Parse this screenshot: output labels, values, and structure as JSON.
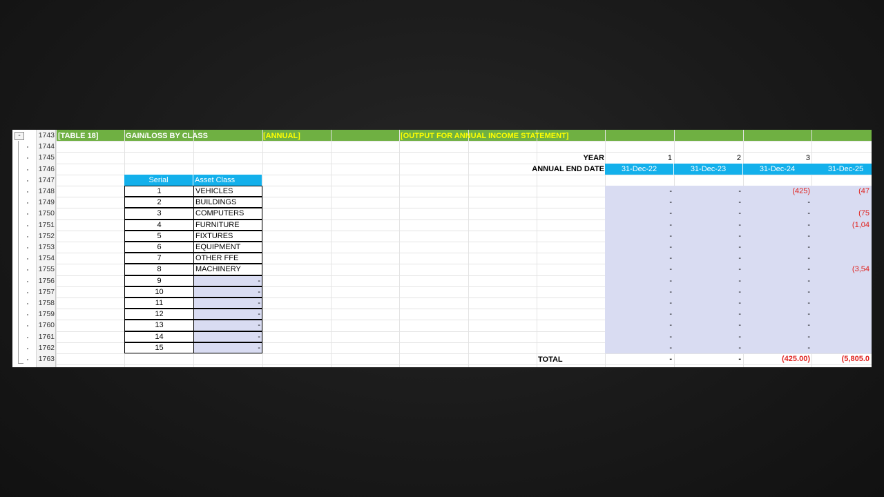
{
  "header": {
    "table_label": "[TABLE 18]",
    "title": "GAIN/LOSS BY CLASS",
    "period": "[ANNUAL]",
    "note": "[OUTPUT FOR ANNUAL INCOME STATEMENT]"
  },
  "row_numbers": [
    "1743",
    "1744",
    "1745",
    "1746",
    "1747",
    "1748",
    "1749",
    "1750",
    "1751",
    "1752",
    "1753",
    "1754",
    "1755",
    "1756",
    "1757",
    "1758",
    "1759",
    "1760",
    "1761",
    "1762",
    "1763"
  ],
  "outline": {
    "collapse_label": "-"
  },
  "labels": {
    "year": "YEAR",
    "end_date": "ANNUAL END DATE",
    "total": "TOTAL"
  },
  "years": [
    "1",
    "2",
    "3"
  ],
  "end_dates": [
    "31-Dec-22",
    "31-Dec-23",
    "31-Dec-24",
    "31-Dec-25"
  ],
  "class_table": {
    "headers": {
      "serial": "Serial",
      "asset_class": "Asset Class"
    },
    "rows": [
      {
        "serial": "1",
        "name": "VEHICLES"
      },
      {
        "serial": "2",
        "name": "BUILDINGS"
      },
      {
        "serial": "3",
        "name": "COMPUTERS"
      },
      {
        "serial": "4",
        "name": "FURNITURE"
      },
      {
        "serial": "5",
        "name": "FIXTURES"
      },
      {
        "serial": "6",
        "name": "EQUIPMENT"
      },
      {
        "serial": "7",
        "name": "OTHER FFE"
      },
      {
        "serial": "8",
        "name": "MACHINERY"
      },
      {
        "serial": "9",
        "name": "-"
      },
      {
        "serial": "10",
        "name": "-"
      },
      {
        "serial": "11",
        "name": "-"
      },
      {
        "serial": "12",
        "name": "-"
      },
      {
        "serial": "13",
        "name": "-"
      },
      {
        "serial": "14",
        "name": "-"
      },
      {
        "serial": "15",
        "name": "-"
      }
    ]
  },
  "values": [
    [
      "-",
      "-",
      "(425)",
      "(47"
    ],
    [
      "-",
      "-",
      "-",
      ""
    ],
    [
      "-",
      "-",
      "-",
      "(75"
    ],
    [
      "-",
      "-",
      "-",
      "(1,04"
    ],
    [
      "-",
      "-",
      "-",
      ""
    ],
    [
      "-",
      "-",
      "-",
      ""
    ],
    [
      "-",
      "-",
      "-",
      ""
    ],
    [
      "-",
      "-",
      "-",
      "(3,54"
    ],
    [
      "-",
      "-",
      "-",
      ""
    ],
    [
      "-",
      "-",
      "-",
      ""
    ],
    [
      "-",
      "-",
      "-",
      ""
    ],
    [
      "-",
      "-",
      "-",
      ""
    ],
    [
      "-",
      "-",
      "-",
      ""
    ],
    [
      "-",
      "-",
      "-",
      ""
    ],
    [
      "-",
      "-",
      "-",
      ""
    ]
  ],
  "totals": [
    "-",
    "-",
    "(425.00)",
    "(5,805.0"
  ],
  "colors": {
    "band_green": "#6fb042",
    "header_blue": "#13b0eb",
    "data_fill": "#d9dcf2",
    "negative_red": "#e0211d",
    "header_yellow": "#ffff00"
  }
}
